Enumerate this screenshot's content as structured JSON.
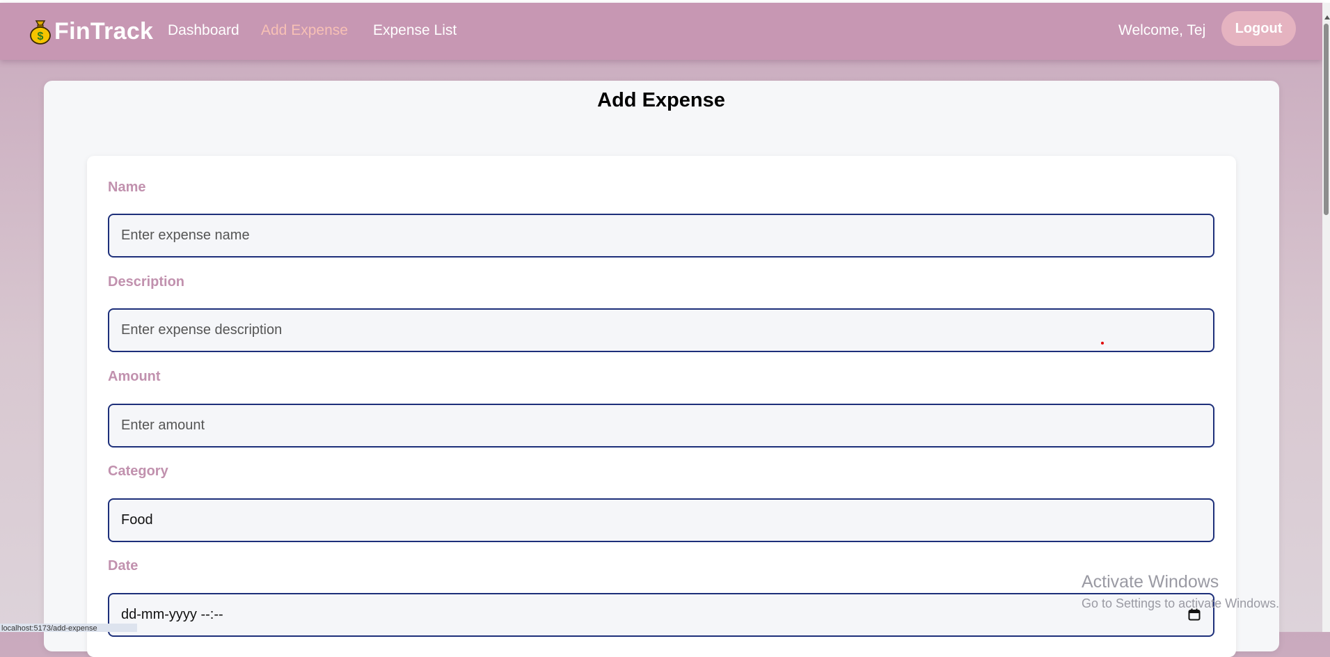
{
  "nav": {
    "brand": "FinTrack",
    "brand_icon": "money-bag-icon",
    "links": [
      "Dashboard",
      "Add Expense",
      "Expense List"
    ],
    "active_link": "Add Expense",
    "welcome": "Welcome, Tej",
    "logout": "Logout"
  },
  "page": {
    "title": "Add Expense"
  },
  "form": {
    "name": {
      "label": "Name",
      "placeholder": "Enter expense name",
      "value": ""
    },
    "description": {
      "label": "Description",
      "placeholder": "Enter expense description",
      "value": ""
    },
    "amount": {
      "label": "Amount",
      "placeholder": "Enter amount",
      "value": ""
    },
    "category": {
      "label": "Category",
      "value": "Food"
    },
    "date": {
      "label": "Date",
      "placeholder": "dd-mm-yyyy --:--",
      "icon": "calendar-icon"
    }
  },
  "watermark": {
    "title": "Activate Windows",
    "subtitle": "Go to Settings to activate Windows."
  },
  "status_bar": {
    "url": "localhost:5173/add-expense"
  },
  "colors": {
    "navbar": "#c797b3",
    "active_link": "#f7c0b5",
    "logout_button": "#e5b3c0",
    "field_label": "#c191ae",
    "input_border": "#1d2f7a"
  }
}
